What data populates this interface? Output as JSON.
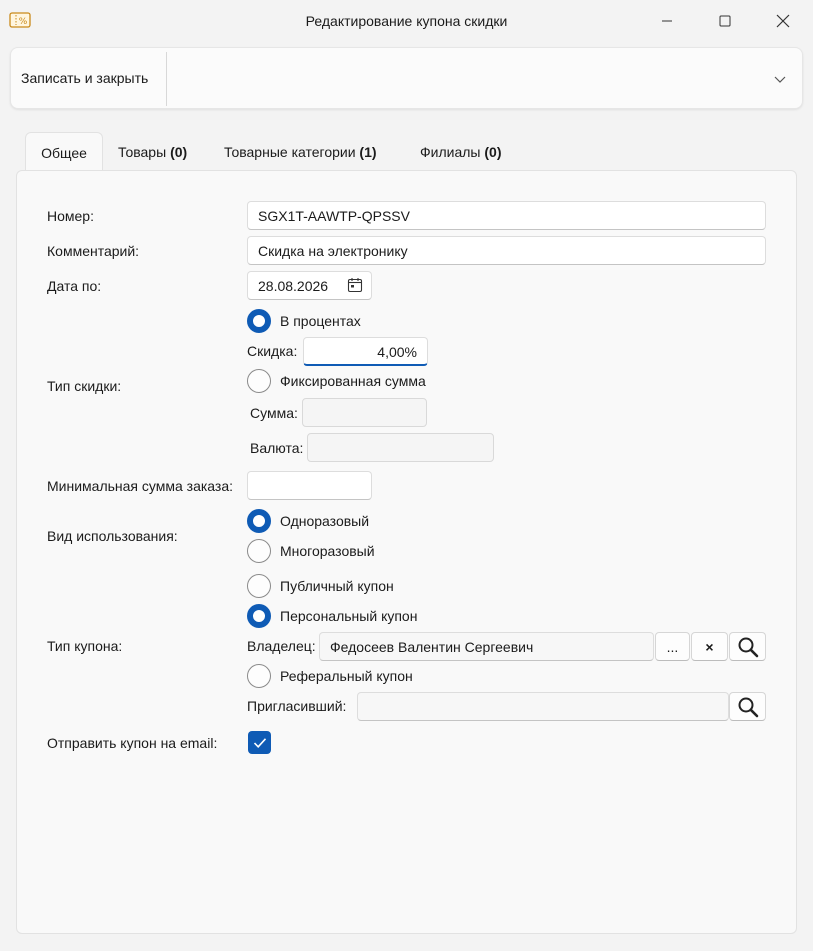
{
  "window": {
    "title": "Редактирование купона скидки",
    "icon": "coupon-percent-icon"
  },
  "toolbar": {
    "save_close_label": "Записать и закрыть",
    "more_icon": "chevron-down-icon"
  },
  "tabs": [
    {
      "label": "Общее",
      "count": ""
    },
    {
      "label": "Товары",
      "count": "(0)"
    },
    {
      "label": "Товарные категории",
      "count": "(1)"
    },
    {
      "label": "Филиалы",
      "count": "(0)"
    }
  ],
  "form": {
    "number_label": "Номер:",
    "number_value": "SGX1T-AAWTP-QPSSV",
    "comment_label": "Комментарий:",
    "comment_value": "Скидка на электронику",
    "date_label": "Дата по:",
    "date_value": "28.08.2026",
    "discount_type_label": "Тип скидки:",
    "percent_option": "В процентах",
    "discount_label": "Скидка:",
    "discount_value": "4,00%",
    "fixed_option": "Фиксированная сумма",
    "sum_label": "Сумма:",
    "sum_value": "",
    "currency_label": "Валюта:",
    "currency_value": "",
    "min_order_label": "Минимальная сумма заказа:",
    "min_order_value": "",
    "usage_label": "Вид использования:",
    "single_use_option": "Одноразовый",
    "multi_use_option": "Многоразовый",
    "coupon_type_label": "Тип купона:",
    "public_option": "Публичный купон",
    "personal_option": "Персональный купон",
    "owner_label": "Владелец:",
    "owner_value": "Федосеев Валентин Сергеевич",
    "ellipsis_label": "...",
    "clear_label": "×",
    "referral_option": "Реферальный купон",
    "inviter_label": "Пригласивший:",
    "inviter_value": "",
    "send_email_label": "Отправить купон на email:",
    "send_email_checked": true
  },
  "colors": {
    "accent": "#0f5bb5",
    "background": "#f3f3f3",
    "panel": "#f9f9f9"
  }
}
